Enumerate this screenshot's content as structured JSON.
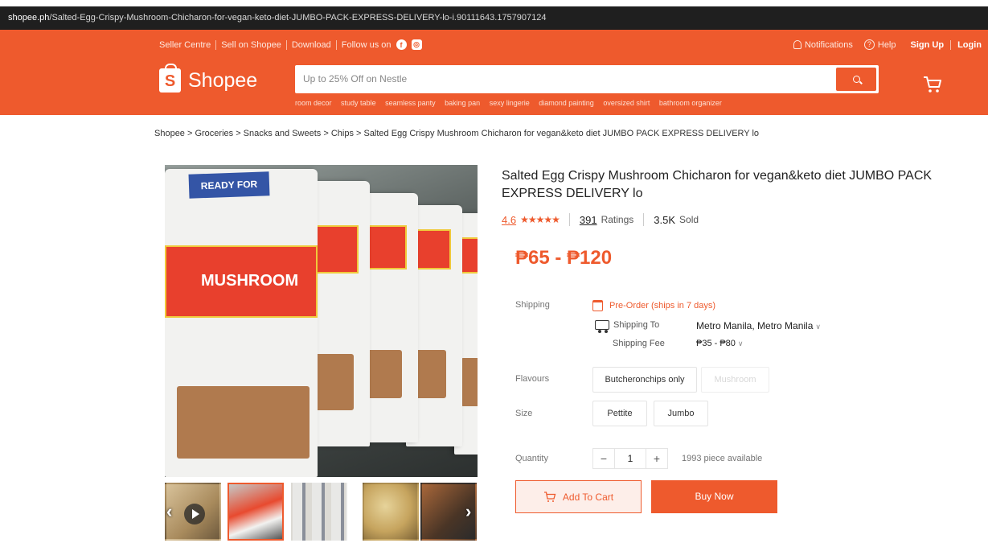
{
  "browser": {
    "url_host": "shopee.ph",
    "url_path": "/Salted-Egg-Crispy-Mushroom-Chicharon-for-vegan-keto-diet-JUMBO-PACK-EXPRESS-DELIVERY-lo-i.90111643.1757907124"
  },
  "header": {
    "top_links": [
      "Seller Centre",
      "Sell on Shopee",
      "Download",
      "Follow us on"
    ],
    "right_links": {
      "notifications": "Notifications",
      "help": "Help",
      "signup": "Sign Up",
      "login": "Login"
    },
    "logo_text": "Shopee",
    "logo_letter": "S",
    "search_placeholder": "Up to 25% Off on Nestle",
    "suggestions": [
      "room decor",
      "study table",
      "seamless panty",
      "baking pan",
      "sexy lingerie",
      "diamond painting",
      "oversized shirt",
      "bathroom organizer"
    ]
  },
  "breadcrumb": "Shopee > Groceries > Snacks and Sweets > Chips > Salted Egg Crispy Mushroom Chicharon for vegan&keto diet JUMBO PACK EXPRESS DELIVERY lo",
  "product": {
    "title": "Salted Egg Crispy Mushroom Chicharon for vegan&keto diet JUMBO PACK EXPRESS DELIVERY lo",
    "rating": "4.6",
    "stars": "★★★★★",
    "ratings_count": "391",
    "ratings_label": "Ratings",
    "sold_count": "3.5K",
    "sold_label": "Sold",
    "price": "₱65 - ₱120",
    "image_label_ready": "READY FOR",
    "image_label_brand": "MUSHROOM"
  },
  "shipping": {
    "label": "Shipping",
    "preorder": "Pre-Order (ships in 7 days)",
    "to_label": "Shipping To",
    "to_value": "Metro Manila, Metro Manila",
    "fee_label": "Shipping Fee",
    "fee_value": "₱35 - ₱80"
  },
  "options": {
    "flavours_label": "Flavours",
    "flavours": [
      "Butcheronchips only",
      "Mushroom"
    ],
    "size_label": "Size",
    "sizes": [
      "Pettite",
      "Jumbo"
    ]
  },
  "quantity": {
    "label": "Quantity",
    "minus": "−",
    "value": "1",
    "plus": "+",
    "available": "1993 piece available"
  },
  "actions": {
    "add_to_cart": "Add To Cart",
    "buy_now": "Buy Now"
  },
  "colors": {
    "brand": "#ee5a2d",
    "page_bg": "#ffffff"
  }
}
